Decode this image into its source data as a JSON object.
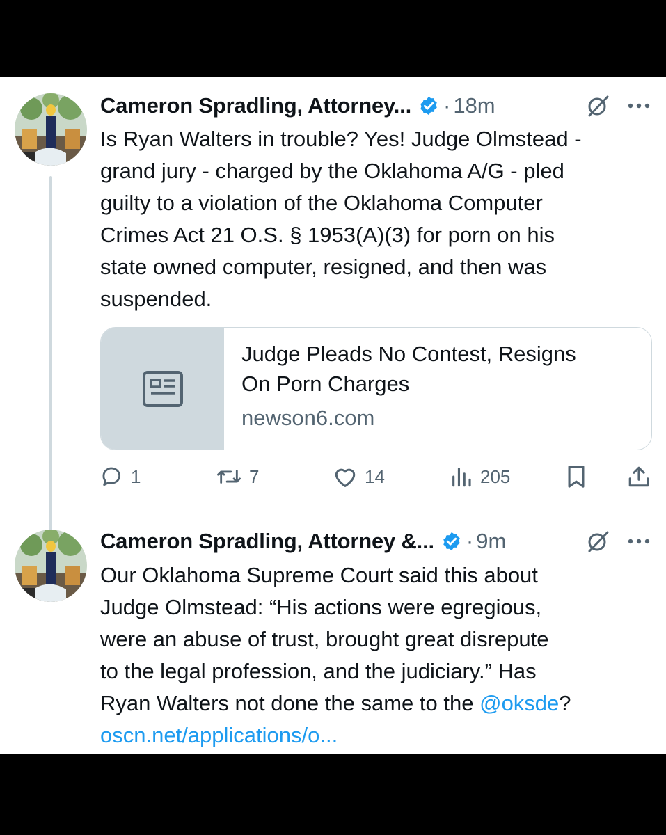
{
  "tweets": [
    {
      "author": "Cameron Spradling, Attorney...",
      "time": "18m",
      "text_lines": [
        "Is Ryan Walters in trouble? Yes! Judge Olmstead -",
        "grand jury - charged by the Oklahoma A/G - pled",
        "guilty to a violation of the Oklahoma Computer",
        "Crimes Act 21 O.S. § 1953(A)(3) for porn on his",
        "state owned computer, resigned, and then was",
        "suspended."
      ],
      "card": {
        "title_lines": [
          "Judge Pleads No Contest, Resigns",
          "On Porn Charges"
        ],
        "domain": "newson6.com"
      },
      "actions": {
        "replies": "1",
        "reposts": "7",
        "likes": "14",
        "views": "205"
      }
    },
    {
      "author": "Cameron Spradling, Attorney &...",
      "time": "9m",
      "text_lines": [
        "Our Oklahoma Supreme Court said this about",
        "Judge Olmstead: “His actions were egregious,",
        "were an abuse of trust, brought great disrepute",
        "to the legal profession, and the judiciary.” Has"
      ],
      "line5_prefix": "Ryan Walters not done the same to the ",
      "mention": "@oksde",
      "line5_suffix": "?",
      "link": "oscn.net/applications/o..."
    }
  ],
  "colors": {
    "accent": "#1d9bf0",
    "secondary_text": "#536471",
    "border": "#cfd9de"
  },
  "icons": [
    "verified-badge-icon",
    "grok-icon",
    "more-icon",
    "article-icon",
    "reply-icon",
    "repost-icon",
    "like-icon",
    "views-icon",
    "bookmark-icon",
    "share-icon"
  ]
}
